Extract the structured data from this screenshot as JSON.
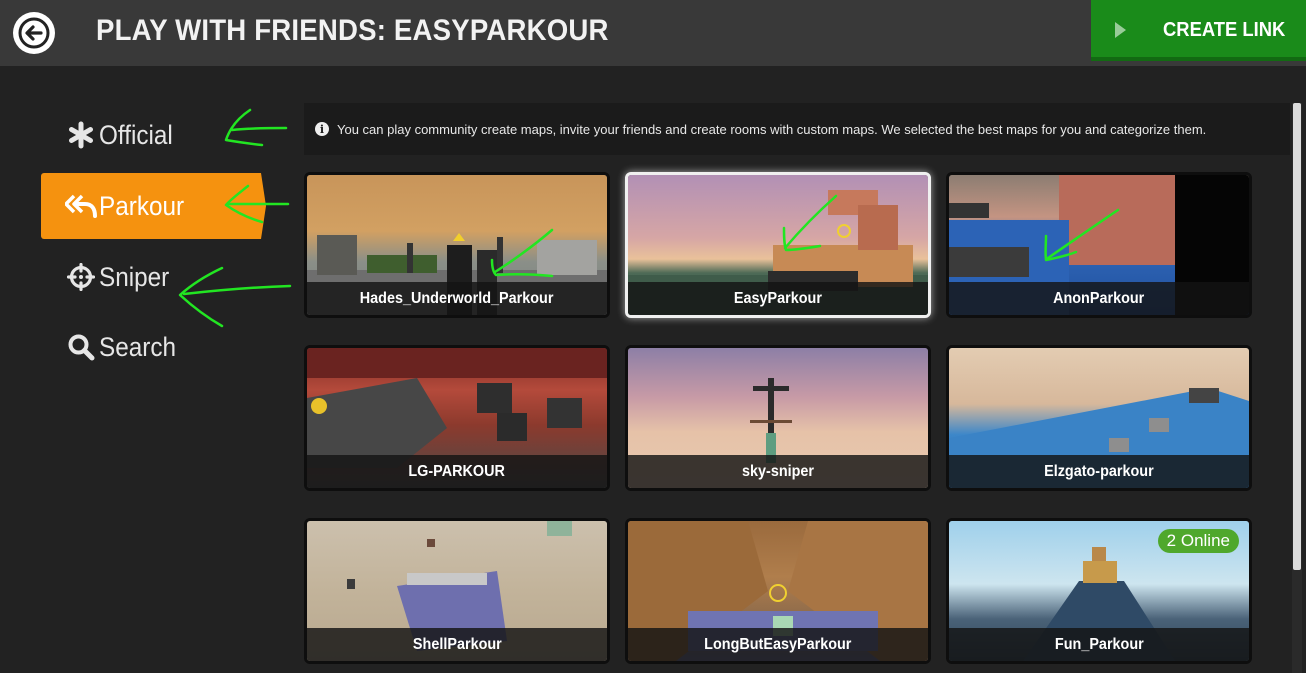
{
  "header": {
    "title": "PLAY WITH FRIENDS: EASYPARKOUR",
    "back_icon": "arrow-left-circle-icon",
    "create_link_label": "CREATE LINK",
    "create_link_icon": "play-icon",
    "accent_green": "#1a8b1a"
  },
  "sidebar": {
    "accent_orange": "#f5920f",
    "items": [
      {
        "label": "Official",
        "icon": "asterisk-icon",
        "active": false
      },
      {
        "label": "Parkour",
        "icon": "reply-all-icon",
        "active": true
      },
      {
        "label": "Sniper",
        "icon": "crosshair-icon",
        "active": false
      },
      {
        "label": "Search",
        "icon": "search-icon",
        "active": false
      }
    ]
  },
  "info": {
    "icon": "info-icon",
    "text": "You can play community create maps, invite your friends and create rooms with custom maps. We selected the best maps for you and categorize them."
  },
  "maps": [
    {
      "name": "Hades_Underworld_Parkour",
      "selected": false
    },
    {
      "name": "EasyParkour",
      "selected": true
    },
    {
      "name": "AnonParkour",
      "selected": false
    },
    {
      "name": "LG-PARKOUR",
      "selected": false
    },
    {
      "name": "sky-sniper",
      "selected": false
    },
    {
      "name": "Elzgato-parkour",
      "selected": false
    },
    {
      "name": "ShellParkour",
      "selected": false
    },
    {
      "name": "LongButEasyParkour",
      "selected": false
    },
    {
      "name": "Fun_Parkour",
      "selected": false,
      "online": "2 Online"
    }
  ]
}
